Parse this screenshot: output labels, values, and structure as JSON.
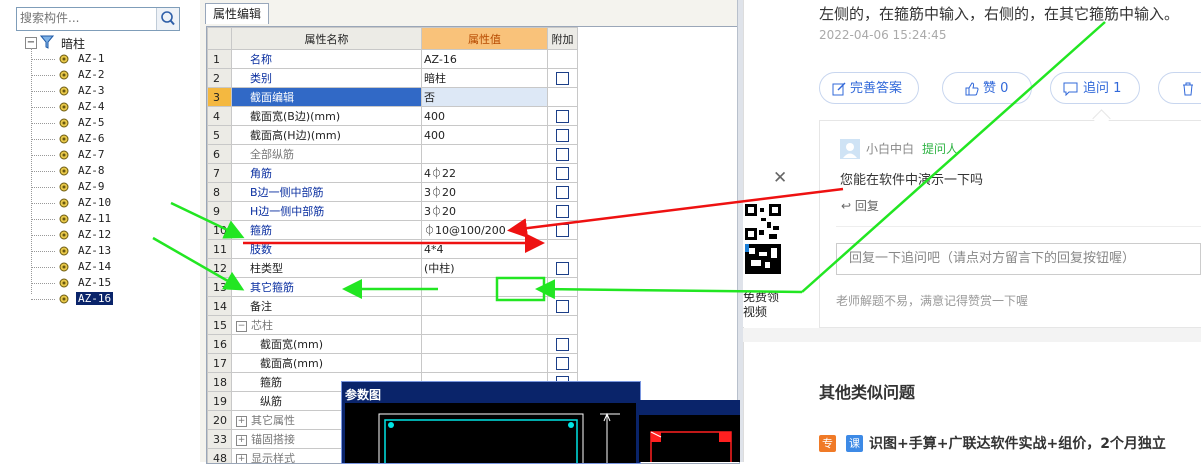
{
  "tree": {
    "search_placeholder": "搜索构件...",
    "root_label": "暗柱",
    "items": [
      "AZ-1",
      "AZ-2",
      "AZ-3",
      "AZ-4",
      "AZ-5",
      "AZ-6",
      "AZ-7",
      "AZ-8",
      "AZ-9",
      "AZ-10",
      "AZ-11",
      "AZ-12",
      "AZ-13",
      "AZ-14",
      "AZ-15",
      "AZ-16"
    ],
    "selected_item": "AZ-16"
  },
  "props": {
    "tab_label": "属性编辑",
    "headers": {
      "num": "",
      "name": "属性名称",
      "value": "属性值",
      "extra": "附加"
    },
    "rows": [
      {
        "num": "1",
        "name": "名称",
        "value": "AZ-16",
        "check": false
      },
      {
        "num": "2",
        "name": "类别",
        "value": "暗柱",
        "check": true
      },
      {
        "num": "3",
        "name": "截面编辑",
        "value": "否",
        "check": false
      },
      {
        "num": "4",
        "name": "截面宽(B边)(mm)",
        "value": "400",
        "check": true
      },
      {
        "num": "5",
        "name": "截面高(H边)(mm)",
        "value": "400",
        "check": true
      },
      {
        "num": "6",
        "name": "全部纵筋",
        "value": "",
        "check": true
      },
      {
        "num": "7",
        "name": "角筋",
        "value": "4⏀22",
        "check": true
      },
      {
        "num": "8",
        "name": "B边一侧中部筋",
        "value": "3⏀20",
        "check": true
      },
      {
        "num": "9",
        "name": "H边一侧中部筋",
        "value": "3⏀20",
        "check": true
      },
      {
        "num": "10",
        "name": "箍筋",
        "value": "⏀10@100/200",
        "check": true
      },
      {
        "num": "11",
        "name": "肢数",
        "value": "4*4",
        "check": false
      },
      {
        "num": "12",
        "name": "柱类型",
        "value": "(中柱)",
        "check": true
      },
      {
        "num": "13",
        "name": "其它箍筋",
        "value": "",
        "check": false
      },
      {
        "num": "14",
        "name": "备注",
        "value": "",
        "check": true
      },
      {
        "num": "15",
        "name": "芯柱",
        "value": "",
        "check": false
      },
      {
        "num": "16",
        "name": "截面宽(mm)",
        "value": "",
        "check": true
      },
      {
        "num": "17",
        "name": "截面高(mm)",
        "value": "",
        "check": true
      },
      {
        "num": "18",
        "name": "箍筋",
        "value": "",
        "check": true
      },
      {
        "num": "19",
        "name": "纵筋",
        "value": "",
        "check": false
      },
      {
        "num": "20",
        "name": "其它属性",
        "value": "",
        "check": false
      },
      {
        "num": "33",
        "name": "锚固搭接",
        "value": "",
        "check": false
      },
      {
        "num": "48",
        "name": "显示样式",
        "value": "",
        "check": false
      }
    ]
  },
  "dialog": {
    "title": "参数图"
  },
  "web": {
    "answer_text": "左侧的，在箍筋中输入，右侧的，在其它箍筋中输入。",
    "answer_time": "2022-04-06 15:24:45",
    "actions": {
      "improve": "完善答案",
      "like": "赞 0",
      "followup": "追问 1"
    },
    "comment": {
      "user": "小白中白",
      "role": "提问人",
      "text": "您能在软件中演示一下吗",
      "reply": "回复",
      "reply_placeholder": "回复一下追问吧（请点对方留言下的回复按钮喔）",
      "tip": "老师解题不易，满意记得赞赏一下喔"
    },
    "qr_caption_1": "免费领",
    "qr_caption_2": "视频",
    "similar_title": "其他类似问题",
    "similar_badges": [
      "专",
      "课"
    ],
    "similar_first": "识图+手算+广联达软件实战+组价，2个月独立"
  },
  "colors": {
    "annotation_green": "#22e622",
    "annotation_red": "#ee1111",
    "link_blue": "#3168d9"
  }
}
